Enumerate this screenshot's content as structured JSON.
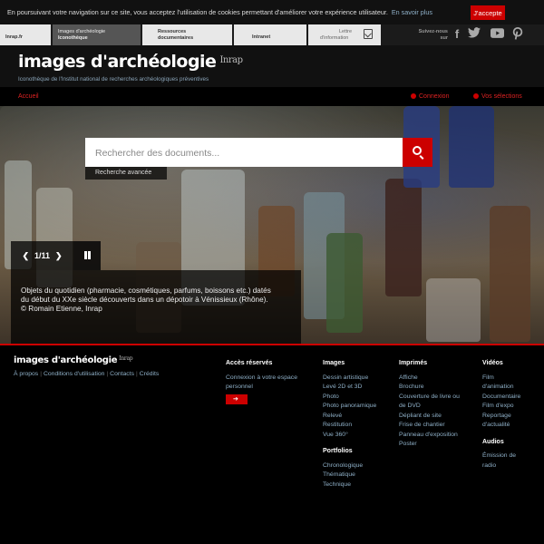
{
  "cookie": {
    "text": "En poursuivant votre navigation sur ce site, vous acceptez l'utilisation de cookies permettant d'améliorer votre expérience utilisateur.",
    "more": "En savoir plus",
    "accept": "J'accepte"
  },
  "topnav": {
    "items": [
      {
        "label": "Inrap.fr"
      },
      {
        "label": "Images d'archéologie",
        "sub": "Iconothèque"
      },
      {
        "label": "Ressources",
        "sub": "documentaires"
      },
      {
        "label": "Intranet"
      },
      {
        "label": "Lettre",
        "sub": "d'information"
      }
    ],
    "follow_line1": "Suivez-nous",
    "follow_line2": "sur",
    "social": [
      "facebook-icon",
      "twitter-icon",
      "youtube-icon",
      "pinterest-icon"
    ]
  },
  "header": {
    "logo": "images d'archéologie",
    "logo_badge": "Inrap",
    "tagline": "Iconothèque de l'Institut national de recherches archéologiques préventives"
  },
  "strip": {
    "home": "Accueil",
    "login": "Connexion",
    "selections": "Vos sélections"
  },
  "hero": {
    "search_placeholder": "Rechercher des documents...",
    "advanced": "Recherche avancée",
    "pager": "1/11",
    "caption_line1": "Objets du quotidien (pharmacie, cosmétiques, parfums, boissons etc.) datés",
    "caption_line2": "du début du XXe siècle découverts dans un dépotoir à Vénissieux (Rhône).",
    "caption_line3": "© Romain Etienne, Inrap"
  },
  "footer": {
    "logo": "images d'archéologie",
    "logo_badge": "Inrap",
    "links": [
      "À propos",
      "Conditions d'utilisation",
      "Contacts",
      "Crédits"
    ],
    "acces": {
      "title": "Accès réservés",
      "line1": "Connexion à votre espace",
      "line2": "personnel"
    },
    "images": {
      "title": "Images",
      "items": [
        "Dessin artistique",
        "Levé 2D et 3D",
        "Photo",
        "Photo panoramique",
        "Relevé",
        "Restitution",
        "Vue 360°"
      ]
    },
    "portfolios": {
      "title": "Portfolios",
      "items": [
        "Chronologique",
        "Thématique",
        "Technique"
      ]
    },
    "imprimes": {
      "title": "Imprimés",
      "items": [
        "Affiche",
        "Brochure",
        "Couverture de livre ou",
        "de DVD",
        "Dépliant de site",
        "Frise de chantier",
        "Panneau d'exposition",
        "Poster"
      ]
    },
    "videos": {
      "title": "Vidéos",
      "items": [
        "Film",
        "d'animation",
        "Documentaire",
        "Film d'expo",
        "Reportage",
        "d'actualité"
      ]
    },
    "audios": {
      "title": "Audios",
      "items": [
        "Émission de",
        "radio"
      ]
    }
  }
}
